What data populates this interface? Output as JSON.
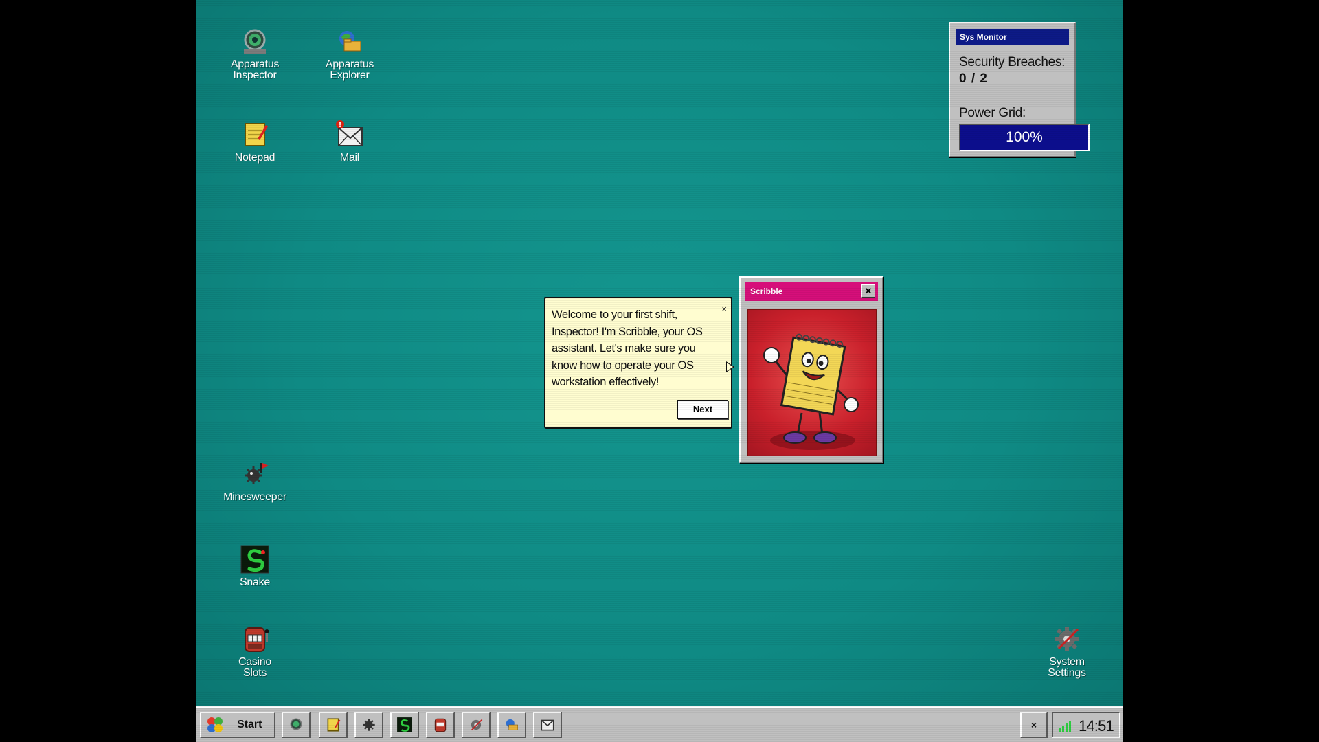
{
  "desktop": {
    "icons": [
      {
        "id": "inspector",
        "label": "Apparatus\nInspector"
      },
      {
        "id": "explorer",
        "label": "Apparatus\nExplorer"
      },
      {
        "id": "notepad",
        "label": "Notepad"
      },
      {
        "id": "mail",
        "label": "Mail",
        "badge": "!"
      },
      {
        "id": "minesweeper",
        "label": "Minesweeper"
      },
      {
        "id": "snake",
        "label": "Snake"
      },
      {
        "id": "casino",
        "label": "Casino\nSlots"
      },
      {
        "id": "settings",
        "label": "System\nSettings"
      }
    ]
  },
  "sys_monitor": {
    "title": "Sys Monitor",
    "breaches_label": "Security Breaches:",
    "breaches_value": "0 / 2",
    "power_label": "Power Grid:",
    "power_value": "100%",
    "power_fraction": 1.0
  },
  "assistant": {
    "window_title": "Scribble",
    "close_label": "✕",
    "message": "Welcome to your first shift, Inspector! I'm Scribble, your OS assistant. Let's make sure you know how to operate your OS workstation effectively!",
    "dismiss_label": "×",
    "next_label": "Next"
  },
  "taskbar": {
    "start_label": "Start",
    "close_label": "×",
    "clock": "14:51"
  },
  "colors": {
    "desktop": "#11918b",
    "title_blue": "#0d1a87",
    "title_pink": "#d60f7a",
    "bubble": "#fffdd0"
  }
}
